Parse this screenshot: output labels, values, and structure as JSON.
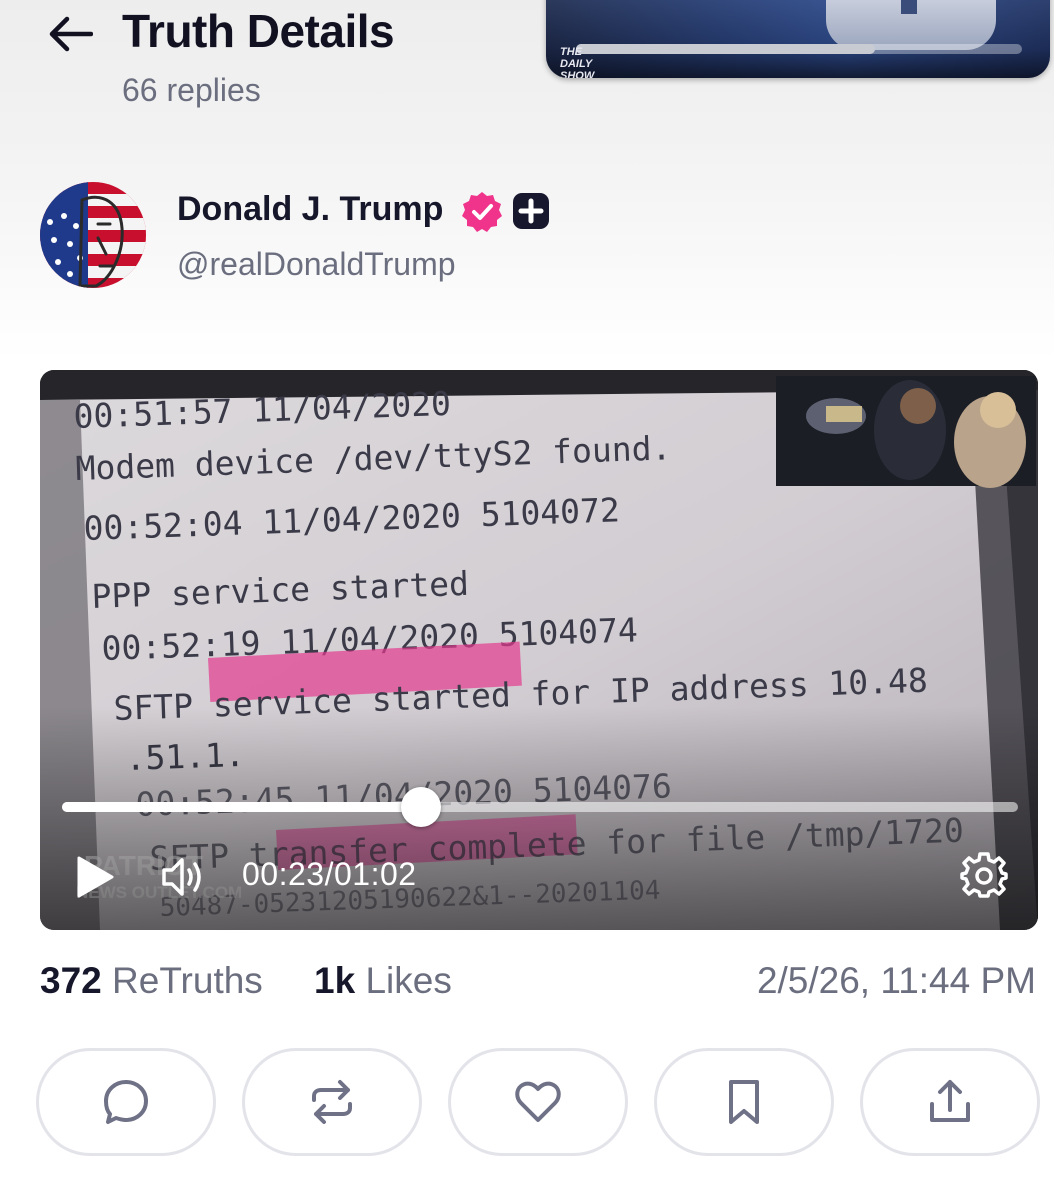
{
  "header": {
    "title": "Truth Details",
    "reply_count": "66 replies",
    "back_icon": "arrow-left-icon"
  },
  "mini_player": {
    "logo_text_1": "THE",
    "logo_text_2": "DAILY",
    "logo_text_3": "SHOW",
    "progress_fraction": 0.67
  },
  "author": {
    "name": "Donald J. Trump",
    "handle": "@realDonaldTrump",
    "verified_badge_color": "#f0348c",
    "plus_badge_color": "#17172e"
  },
  "video": {
    "frame_text": {
      "line1": "00:51:57     11/04/2020",
      "line2": "Modem device /dev/ttyS2 found.",
      "line3": "00:52:04    11/04/2020 5104072",
      "line4": "PPP service started",
      "line5": "00:52:19    11/04/2020 5104074",
      "line6": "SFTP service started for IP address 10.48",
      "line7": ".51.1.",
      "line8": "00:52:45    11/04/2020 5104076",
      "line9": "SFTP transfer complete for file /tmp/1720",
      "line10": "50487-05231205190622&1--20201104",
      "watermark_1": "PATRIOT",
      "watermark_2": "NEWS OUTLET.COM"
    },
    "current_time": "00:23",
    "time_separator": "/",
    "duration": "01:02",
    "progress_fraction": 0.375,
    "highlight_color": "#e23a8f",
    "icons": [
      "play-icon",
      "volume-icon",
      "gear-icon"
    ]
  },
  "stats": {
    "retruths_count": "372",
    "retruths_label": "ReTruths",
    "likes_count": "1k",
    "likes_label": "Likes",
    "timestamp": "2/5/26, 11:44 PM"
  },
  "actions": [
    {
      "name": "reply",
      "icon": "comment-icon"
    },
    {
      "name": "retruth",
      "icon": "repost-icon"
    },
    {
      "name": "like",
      "icon": "heart-icon"
    },
    {
      "name": "bookmark",
      "icon": "bookmark-icon"
    },
    {
      "name": "share",
      "icon": "share-icon"
    }
  ],
  "colors": {
    "title_text": "#111122",
    "secondary_text": "#6b6e7e",
    "icon_stroke": "#6f7187",
    "button_border": "#e3e3ea"
  }
}
